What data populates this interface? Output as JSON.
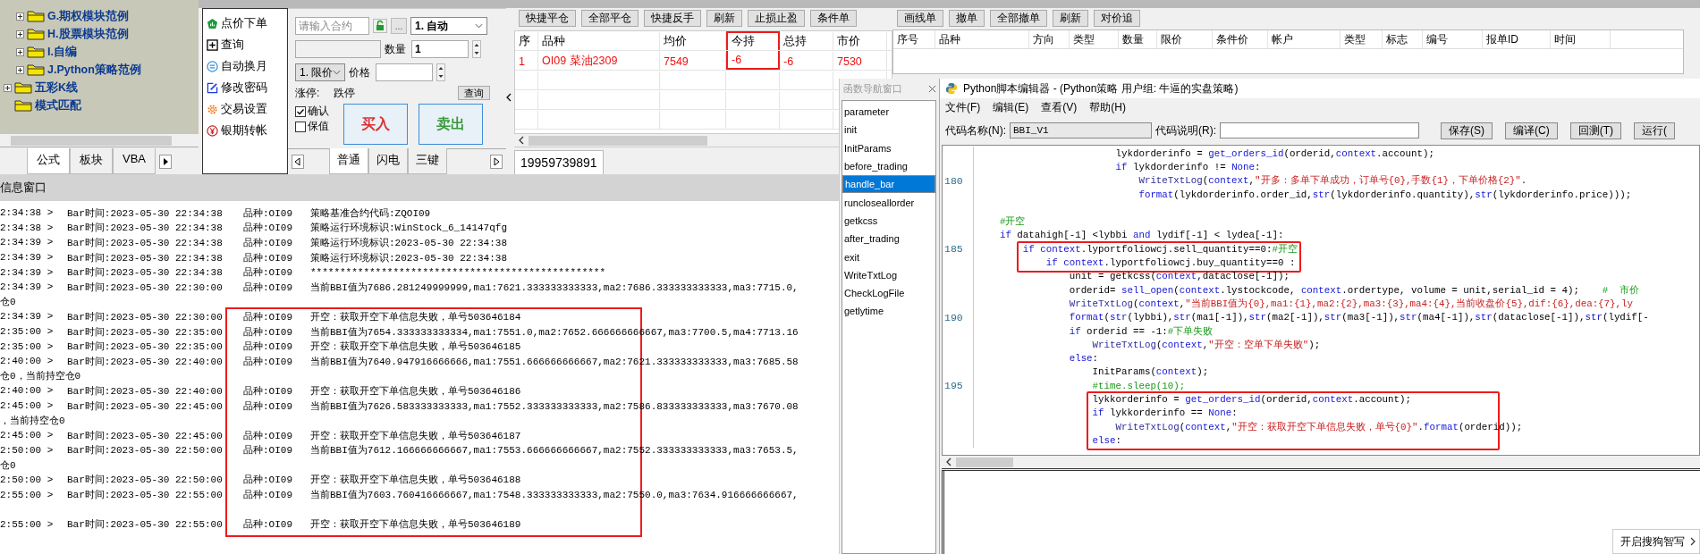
{
  "tree": {
    "branch_items": [
      {
        "label": "G.期权模块范例",
        "expandable": true
      },
      {
        "label": "H.股票模块范例",
        "expandable": true
      },
      {
        "label": "I.自编",
        "expandable": true
      },
      {
        "label": "J.Python策略范例",
        "expandable": true
      }
    ],
    "items": [
      {
        "label": "五彩K线",
        "expandable": true
      },
      {
        "label": "模式匹配",
        "expandable": false
      }
    ]
  },
  "left_tabs": [
    {
      "label": "公式",
      "selected": true
    },
    {
      "label": "板块",
      "selected": false
    },
    {
      "label": "VBA",
      "selected": false
    }
  ],
  "order_menu": [
    {
      "label": "点价下单"
    },
    {
      "label": "查询"
    },
    {
      "label": "自动换月"
    },
    {
      "label": "修改密码"
    },
    {
      "label": "交易设置"
    },
    {
      "label": "银期转帐"
    }
  ],
  "order_form": {
    "contract": {
      "placeholder": "请输入合约"
    },
    "locked": false,
    "more_button": "...",
    "mode": "1. 自动",
    "quantity_label": "数量",
    "quantity": "1",
    "price_type": "1. 限价",
    "price_label": "价格",
    "limit_up": "涨停:",
    "limit_down": "跌停",
    "query_button": "查询",
    "checkboxes": [
      {
        "label": "确认",
        "checked": true
      },
      {
        "label": "保值",
        "checked": false
      }
    ],
    "buy_button": "买入",
    "sell_button": "卖出"
  },
  "order_tabs": [
    {
      "label": "普通",
      "selected": true
    },
    {
      "label": "闪电",
      "selected": false
    },
    {
      "label": "三键",
      "selected": false
    }
  ],
  "positions": {
    "buttons": [
      "快捷平仓",
      "全部平仓",
      "快捷反手",
      "刷新",
      "止损止盈",
      "条件单"
    ],
    "columns": [
      {
        "label": "序",
        "highlighted": false
      },
      {
        "label": "品种",
        "highlighted": false
      },
      {
        "label": "均价",
        "highlighted": false
      },
      {
        "label": "今持",
        "highlighted": true
      },
      {
        "label": "总持",
        "highlighted": false
      },
      {
        "label": "市价",
        "highlighted": false
      }
    ],
    "rows": [
      [
        "1",
        "OI09 菜油2309",
        "7549",
        "-6",
        "-6",
        "7530"
      ]
    ],
    "account_tab": "19959739891"
  },
  "orders": {
    "buttons": [
      "画线单",
      "撤单",
      "全部撤单",
      "刷新",
      "对价追"
    ],
    "columns": [
      "序号",
      "品种",
      "方向",
      "类型",
      "数量",
      "限价",
      "条件价",
      "帐户",
      "类型",
      "标志",
      "编号",
      "报单ID",
      "时间"
    ]
  },
  "log": {
    "title": "信息窗口",
    "blocks": [
      {
        "highlighted": false,
        "lines": [
          {
            "kind": "entry",
            "time": "2:34:38 >",
            "bar": "Bar时间:2023-05-30 22:34:38",
            "symbol": "品种:OI09",
            "message": "策略基准合约代码:ZQOI09"
          },
          {
            "kind": "entry",
            "time": "2:34:38 >",
            "bar": "Bar时间:2023-05-30 22:34:38",
            "symbol": "品种:OI09",
            "message": "策略运行环境标识:WinStock_6_14147qfg"
          },
          {
            "kind": "entry",
            "time": "2:34:39 >",
            "bar": "Bar时间:2023-05-30 22:34:38",
            "symbol": "品种:OI09",
            "message": "策略运行环境标识:2023-05-30 22:34:38"
          },
          {
            "kind": "entry",
            "time": "2:34:39 >",
            "bar": "Bar时间:2023-05-30 22:34:38",
            "symbol": "品种:OI09",
            "message": "策略运行环境标识:2023-05-30 22:34:38"
          },
          {
            "kind": "entry",
            "time": "2:34:39 >",
            "bar": "Bar时间:2023-05-30 22:34:38",
            "symbol": "品种:OI09",
            "message": "**************************************************"
          },
          {
            "kind": "entry",
            "time": "2:34:39 >",
            "bar": "Bar时间:2023-05-30 22:30:00",
            "symbol": "品种:OI09",
            "message": "当前BBI值为7686.281249999999,ma1:7621.333333333333,ma2:7686.333333333333,ma3:7715.0,"
          },
          {
            "kind": "wrap",
            "text": "仓0"
          }
        ]
      },
      {
        "highlighted": true,
        "lines": [
          {
            "kind": "entry",
            "time": "2:34:39 >",
            "bar": "Bar时间:2023-05-30 22:30:00",
            "symbol": "品种:OI09",
            "message": "开空：获取开空下单信息失败，单号503646184"
          },
          {
            "kind": "entry",
            "time": "2:35:00 >",
            "bar": "Bar时间:2023-05-30 22:35:00",
            "symbol": "品种:OI09",
            "message": "当前BBI值为7654.333333333334,ma1:7551.0,ma2:7652.666666666667,ma3:7700.5,ma4:7713.16"
          },
          {
            "kind": "entry",
            "time": "2:35:00 >",
            "bar": "Bar时间:2023-05-30 22:35:00",
            "symbol": "品种:OI09",
            "message": "开空：获取开空下单信息失败，单号503646185"
          },
          {
            "kind": "entry",
            "time": "2:40:00 >",
            "bar": "Bar时间:2023-05-30 22:40:00",
            "symbol": "品种:OI09",
            "message": "当前BBI值为7640.947916666666,ma1:7551.666666666667,ma2:7621.333333333333,ma3:7685.58"
          },
          {
            "kind": "wrap",
            "text": "仓0，当前持空仓0"
          },
          {
            "kind": "entry",
            "time": "2:40:00 >",
            "bar": "Bar时间:2023-05-30 22:40:00",
            "symbol": "品种:OI09",
            "message": "开空：获取开空下单信息失败，单号503646186"
          },
          {
            "kind": "entry",
            "time": "2:45:00 >",
            "bar": "Bar时间:2023-05-30 22:45:00",
            "symbol": "品种:OI09",
            "message": "当前BBI值为7626.583333333333,ma1:7552.333333333333,ma2:7586.833333333333,ma3:7670.08"
          },
          {
            "kind": "wrap",
            "text": "，当前持空仓0"
          },
          {
            "kind": "entry",
            "time": "2:45:00 >",
            "bar": "Bar时间:2023-05-30 22:45:00",
            "symbol": "品种:OI09",
            "message": "开空：获取开空下单信息失败，单号503646187"
          },
          {
            "kind": "entry",
            "time": "2:50:00 >",
            "bar": "Bar时间:2023-05-30 22:50:00",
            "symbol": "品种:OI09",
            "message": "当前BBI值为7612.166666666667,ma1:7553.666666666667,ma2:7552.333333333333,ma3:7653.5,"
          },
          {
            "kind": "wrap",
            "text": "仓0"
          },
          {
            "kind": "entry",
            "time": "2:50:00 >",
            "bar": "Bar时间:2023-05-30 22:50:00",
            "symbol": "品种:OI09",
            "message": "开空：获取开空下单信息失败，单号503646188"
          },
          {
            "kind": "entry",
            "time": "2:55:00 >",
            "bar": "Bar时间:2023-05-30 22:55:00",
            "symbol": "品种:OI09",
            "message": "当前BBI值为7603.760416666667,ma1:7548.333333333333,ma2:7550.0,ma3:7634.916666666667,"
          },
          {
            "kind": "blank"
          },
          {
            "kind": "entry",
            "time": "2:55:00 >",
            "bar": "Bar时间:2023-05-30 22:55:00",
            "symbol": "品种:OI09",
            "message": "开空：获取开空下单信息失败，单号503646189"
          }
        ]
      }
    ]
  },
  "function_nav": {
    "title": "函数导航窗口",
    "items": [
      {
        "label": "parameter",
        "selected": false
      },
      {
        "label": "init",
        "selected": false
      },
      {
        "label": "InitParams",
        "selected": false
      },
      {
        "label": "before_trading",
        "selected": false
      },
      {
        "label": "handle_bar",
        "selected": true
      },
      {
        "label": "runcloseallorder",
        "selected": false
      },
      {
        "label": "getkcss",
        "selected": false
      },
      {
        "label": "after_trading",
        "selected": false
      },
      {
        "label": "exit",
        "selected": false
      },
      {
        "label": "WriteTxtLog",
        "selected": false
      },
      {
        "label": "CheckLogFile",
        "selected": false
      },
      {
        "label": "getlytime",
        "selected": false
      }
    ]
  },
  "editor": {
    "title": "Python脚本编辑器 - (Python策略 用户组: 牛逼的实盘策略)",
    "menu": [
      "文件(F)",
      "编辑(E)",
      "查看(V)",
      "帮助(H)"
    ],
    "code_name_label": "代码名称(N):",
    "code_name": "BBI_V1",
    "code_desc_label": "代码说明(R):",
    "buttons": [
      "保存(S)",
      "编译(C)",
      "回测(T)",
      "运行("
    ],
    "code_blocks": [
      {
        "highlighted": false,
        "lines": [
          {
            "text": "                        lykdorderinfo = get_orders_id(orderid,context.account);"
          },
          {
            "text": "                        if lykdorderinfo != None:"
          },
          {
            "number": "180",
            "text": "                            WriteTxtLog(context,\"开多：多单下单成功，订单号{0},手数{1}，下单价格{2}\"."
          },
          {
            "text": "                            format(lykdorderinfo.order_id,str(lykdorderinfo.quantity),str(lykdorderinfo.price)));"
          },
          {
            "kind": "blank"
          },
          {
            "text": "    #开空"
          },
          {
            "text": "    if datahigh[-1] <lybbi and lydif[-1] < lydea[-1]:"
          }
        ]
      },
      {
        "highlighted": true,
        "lines": [
          {
            "number": "185",
            "text": "        if context.lyportfoliowcj.sell_quantity==0:#开空"
          },
          {
            "text": "            if context.lyportfoliowcj.buy_quantity==0 :"
          }
        ]
      },
      {
        "highlighted": false,
        "lines": [
          {
            "text": "                unit = getkcss(context,dataclose[-1]);"
          },
          {
            "text": "                orderid= sell_open(context.lystockcode, context.ordertype, volume = unit,serial_id = 4);    #  市价"
          },
          {
            "text": "                WriteTxtLog(context,\"当前BBI值为{0},ma1:{1},ma2:{2},ma3:{3},ma4:{4},当前收盘价{5},dif:{6},dea:{7},ly"
          },
          {
            "number": "190",
            "text": "                format(str(lybbi),str(ma1[-1]),str(ma2[-1]),str(ma3[-1]),str(ma4[-1]),str(dataclose[-1]),str(lydif[-"
          },
          {
            "text": "                if orderid == -1:#下单失败"
          },
          {
            "text": "                    WriteTxtLog(context,\"开空：空单下单失败\");"
          },
          {
            "text": "                else:"
          },
          {
            "text": "                    InitParams(context);"
          },
          {
            "number": "195",
            "text": "                    #time.sleep(10);"
          }
        ]
      },
      {
        "highlighted": true,
        "lines": [
          {
            "text": "                    lykkorderinfo = get_orders_id(orderid,context.account);"
          },
          {
            "text": "                    if lykkorderinfo == None:"
          },
          {
            "text": "                        WriteTxtLog(context,\"开空：获取开空下单信息失败，单号{0}\".format(orderid));"
          },
          {
            "text": "                    else:"
          }
        ]
      }
    ]
  },
  "ime_popup": "开启搜狗智写"
}
